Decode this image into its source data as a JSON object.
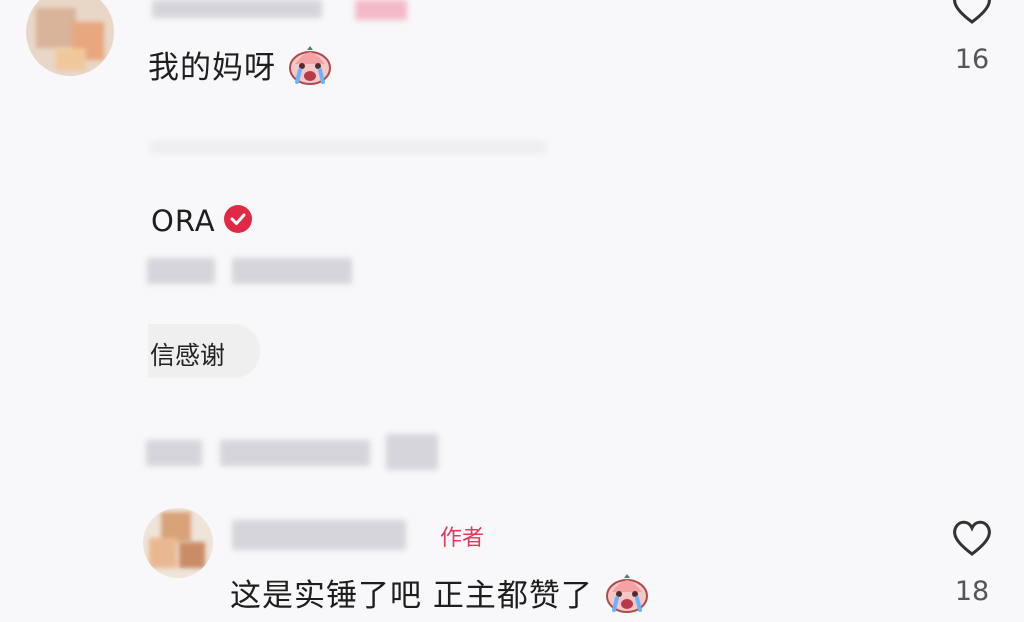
{
  "comments": [
    {
      "text": "我的妈呀",
      "like_count": "16",
      "emoji": "crying-face"
    },
    {
      "text": "这是实锤了吧 正主都赞了",
      "like_count": "18",
      "emoji": "crying-face",
      "badge": "作者"
    }
  ],
  "verified_user": {
    "name": "ORA"
  },
  "reply_chip": {
    "text": "信感谢"
  },
  "colors": {
    "accent": "#e02a45",
    "badge_text": "#e8385a",
    "background": "#f8f8fb"
  }
}
